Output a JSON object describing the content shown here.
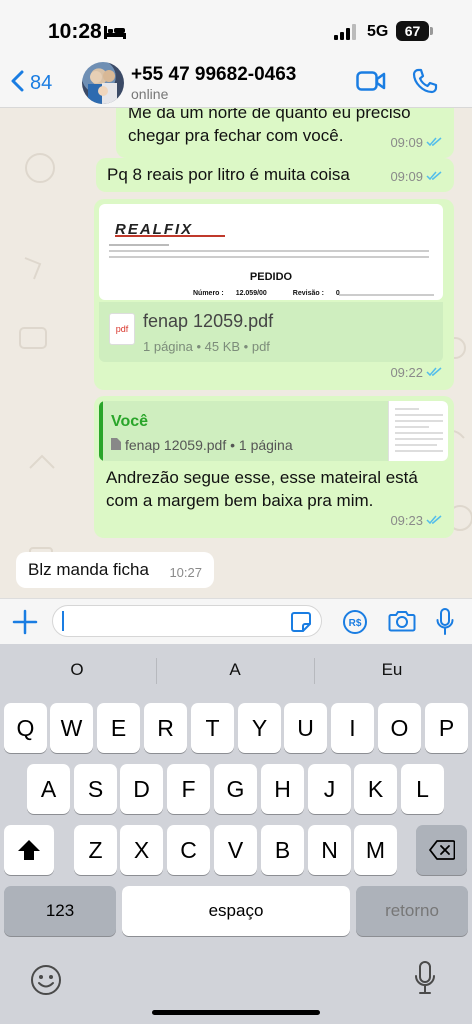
{
  "status_bar": {
    "time": "10:28",
    "network": "5G",
    "battery": "67"
  },
  "header": {
    "back_count": "84",
    "contact_name": "+55 47 99682-0463",
    "contact_status": "online"
  },
  "messages": [
    {
      "direction": "out",
      "text_lines": [
        "Me da um norte de quanto eu preciso",
        "chegar pra fechar com você."
      ],
      "time": "09:09"
    },
    {
      "direction": "out",
      "text": "Pq 8 reais por litro é muita coisa",
      "time": "09:09"
    },
    {
      "direction": "out",
      "type": "document",
      "preview": {
        "brand": "REALFIX",
        "title": "PEDIDO",
        "numero_label": "Número :",
        "numero": "12.059/00",
        "revisao_label": "Revisão :",
        "revisao": "0"
      },
      "file_name": "fenap 12059.pdf",
      "file_icon": "pdf",
      "file_details": "1 página • 45 KB • pdf",
      "time": "09:22"
    },
    {
      "direction": "out",
      "type": "reply",
      "quote": {
        "author": "Você",
        "text": "fenap 12059.pdf • 1 página"
      },
      "text_lines": [
        "Andrezão segue esse, esse mateiral está",
        "com a margem bem baixa pra mim."
      ],
      "time": "09:23"
    },
    {
      "direction": "in",
      "text": "Blz manda ficha",
      "time": "10:27"
    }
  ],
  "composer": {
    "placeholder": ""
  },
  "keyboard": {
    "suggestions": [
      "O",
      "A",
      "Eu"
    ],
    "row1": [
      "Q",
      "W",
      "E",
      "R",
      "T",
      "Y",
      "U",
      "I",
      "O",
      "P"
    ],
    "row2": [
      "A",
      "S",
      "D",
      "F",
      "G",
      "H",
      "J",
      "K",
      "L"
    ],
    "row3": [
      "Z",
      "X",
      "C",
      "V",
      "B",
      "N",
      "M"
    ],
    "numbers_label": "123",
    "space_label": "espaço",
    "return_label": "retorno"
  },
  "colors": {
    "accent": "#1a7de2",
    "outgoing_bubble": "#dcf8c6",
    "incoming_bubble": "#ffffff",
    "read_ticks": "#53bdeb",
    "quote_author": "#2aa52a"
  }
}
